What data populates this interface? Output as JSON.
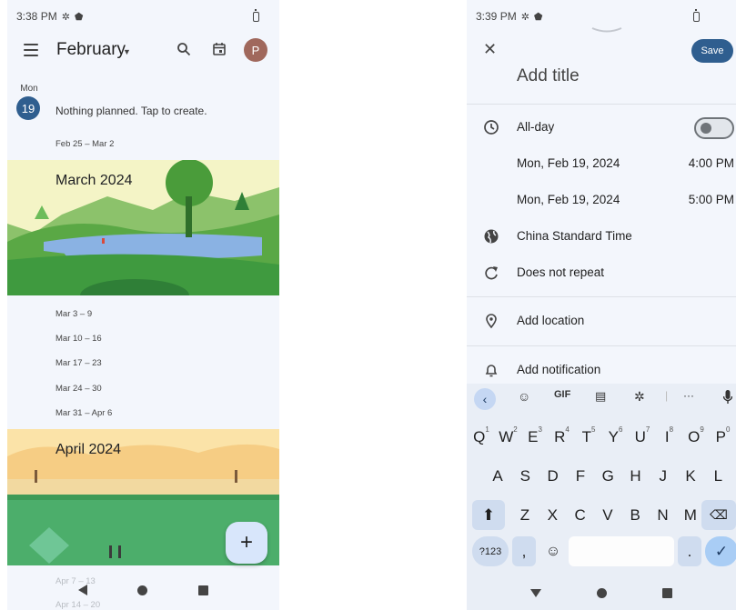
{
  "left": {
    "status": {
      "time": "3:38 PM"
    },
    "header": {
      "month": "February",
      "avatar_letter": "P"
    },
    "today": {
      "day_name": "Mon",
      "day_num": "19",
      "message": "Nothing planned. Tap to create."
    },
    "weeks_before": [
      "Feb 25 – Mar 2"
    ],
    "banner_march": "March 2024",
    "weeks_march": [
      "Mar 3 – 9",
      "Mar 10 – 16",
      "Mar 17 – 23",
      "Mar 24 – 30",
      "Mar 31 – Apr 6"
    ],
    "banner_april": "April 2024",
    "weeks_april": [
      "Apr 7 – 13",
      "Apr 14 – 20"
    ],
    "fab_label": "+"
  },
  "right": {
    "status": {
      "time": "3:39 PM"
    },
    "save_label": "Save",
    "title_placeholder": "Add title",
    "allday_label": "All-day",
    "start": {
      "date": "Mon, Feb 19, 2024",
      "time": "4:00 PM"
    },
    "end": {
      "date": "Mon, Feb 19, 2024",
      "time": "5:00 PM"
    },
    "timezone": "China Standard Time",
    "repeat": "Does not repeat",
    "location": "Add location",
    "notification": "Add notification",
    "keyboard": {
      "tools": [
        "GIF",
        "···"
      ],
      "row1": [
        [
          "Q",
          "1"
        ],
        [
          "W",
          "2"
        ],
        [
          "E",
          "3"
        ],
        [
          "R",
          "4"
        ],
        [
          "T",
          "5"
        ],
        [
          "Y",
          "6"
        ],
        [
          "U",
          "7"
        ],
        [
          "I",
          "8"
        ],
        [
          "O",
          "9"
        ],
        [
          "P",
          "0"
        ]
      ],
      "row2": [
        "A",
        "S",
        "D",
        "F",
        "G",
        "H",
        "J",
        "K",
        "L"
      ],
      "row3": [
        "Z",
        "X",
        "C",
        "V",
        "B",
        "N",
        "M"
      ],
      "symbols_label": "?123",
      "comma": ",",
      "period": "."
    }
  }
}
